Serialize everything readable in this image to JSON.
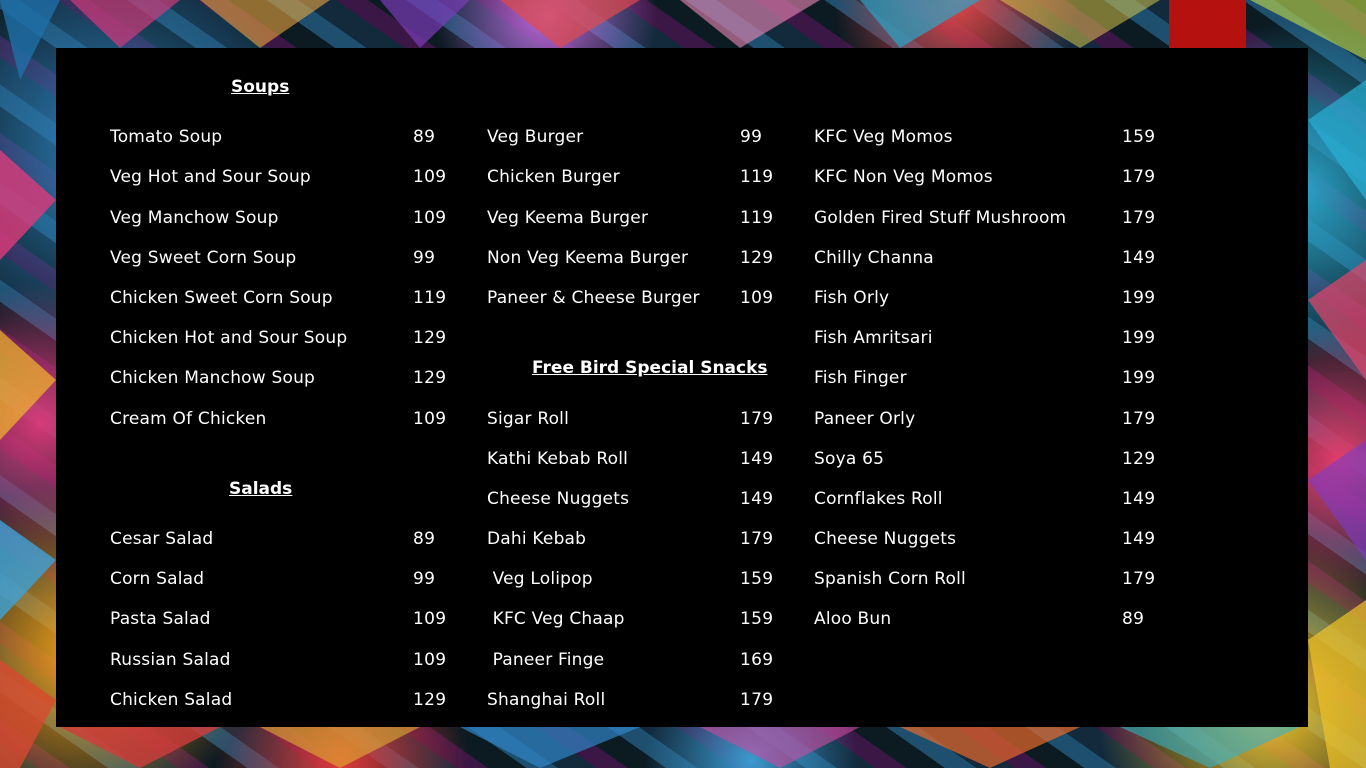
{
  "colors": {
    "panel": "#000000",
    "text": "#ffffff",
    "accent": "#b5120f"
  },
  "columns": [
    {
      "sections": [
        {
          "heading": "Soups",
          "items": [
            {
              "name": "Tomato Soup",
              "price": "89"
            },
            {
              "name": "Veg Hot and Sour Soup",
              "price": "109"
            },
            {
              "name": "Veg Manchow Soup",
              "price": "109"
            },
            {
              "name": "Veg Sweet Corn Soup",
              "price": "99"
            },
            {
              "name": "Chicken Sweet Corn Soup",
              "price": "119"
            },
            {
              "name": "Chicken Hot and Sour Soup",
              "price": "129"
            },
            {
              "name": "Chicken Manchow Soup",
              "price": "129"
            },
            {
              "name": "Cream Of Chicken",
              "price": "109"
            }
          ]
        },
        {
          "heading": "Salads",
          "items": [
            {
              "name": "Cesar Salad",
              "price": "89"
            },
            {
              "name": "Corn Salad",
              "price": "99"
            },
            {
              "name": "Pasta Salad",
              "price": "109"
            },
            {
              "name": "Russian Salad",
              "price": "109"
            },
            {
              "name": "Chicken Salad",
              "price": "129"
            }
          ]
        }
      ]
    },
    {
      "sections": [
        {
          "heading": "",
          "items": [
            {
              "name": "Veg Burger",
              "price": "99"
            },
            {
              "name": "Chicken Burger",
              "price": "119"
            },
            {
              "name": "Veg Keema Burger",
              "price": "119"
            },
            {
              "name": "Non Veg Keema Burger",
              "price": "129"
            },
            {
              "name": "Paneer & Cheese Burger",
              "price": "109"
            }
          ]
        },
        {
          "heading": "Free Bird Special Snacks",
          "items": [
            {
              "name": "Sigar Roll",
              "price": "179"
            },
            {
              "name": "Kathi Kebab Roll",
              "price": "149"
            },
            {
              "name": "Cheese Nuggets",
              "price": "149"
            },
            {
              "name": "Dahi Kebab",
              "price": "179"
            },
            {
              "name": " Veg Lolipop",
              "price": "159"
            },
            {
              "name": " KFC Veg Chaap",
              "price": "159"
            },
            {
              "name": " Paneer Finge",
              "price": "169"
            },
            {
              "name": "Shanghai Roll",
              "price": "179"
            }
          ]
        }
      ]
    },
    {
      "sections": [
        {
          "heading": "",
          "items": [
            {
              "name": "KFC Veg Momos",
              "price": "159"
            },
            {
              "name": "KFC Non Veg Momos",
              "price": "179"
            },
            {
              "name": "Golden Fired Stuff Mushroom",
              "price": "179"
            },
            {
              "name": "Chilly Channa",
              "price": "149"
            },
            {
              "name": "Fish Orly",
              "price": "199"
            },
            {
              "name": "Fish Amritsari",
              "price": "199"
            },
            {
              "name": "Fish Finger",
              "price": "199"
            },
            {
              "name": "Paneer Orly",
              "price": "179"
            },
            {
              "name": "Soya 65",
              "price": "129"
            },
            {
              "name": "Cornflakes Roll",
              "price": "149"
            },
            {
              "name": "Cheese Nuggets",
              "price": "149"
            },
            {
              "name": "Spanish Corn Roll",
              "price": "179"
            },
            {
              "name": "Aloo Bun",
              "price": "89"
            }
          ]
        }
      ]
    }
  ]
}
